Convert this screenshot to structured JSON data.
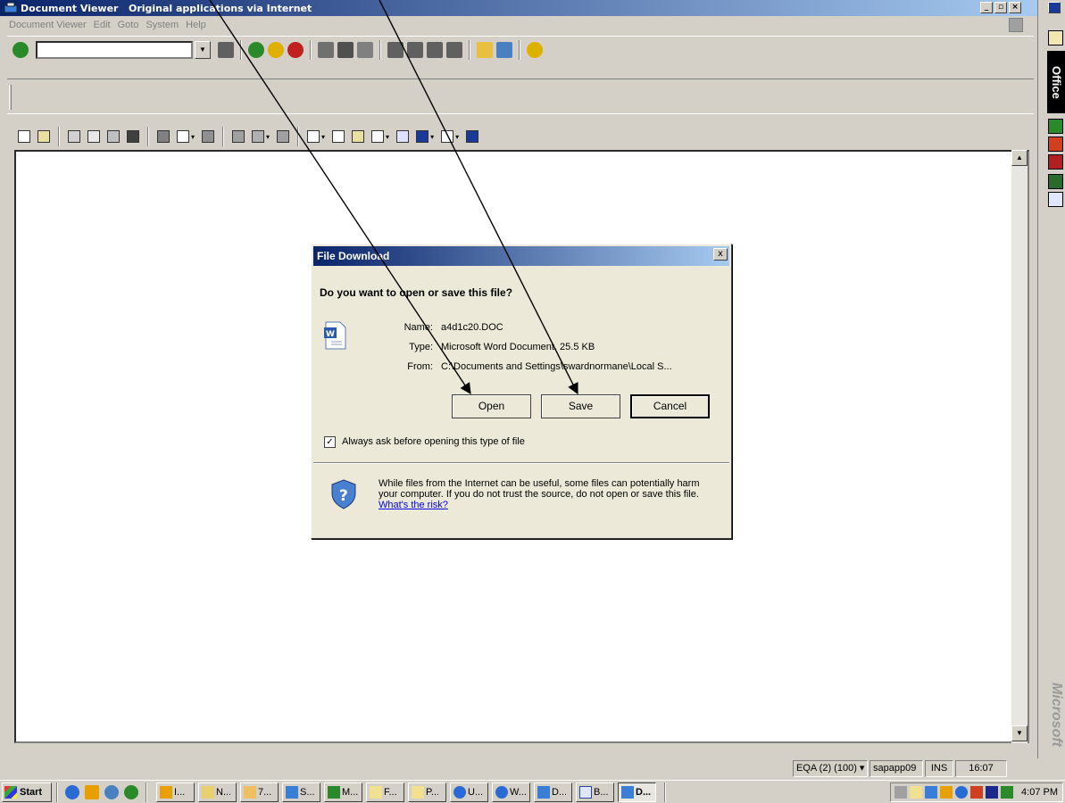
{
  "window": {
    "title": "Document Viewer   Original applications via Internet"
  },
  "menu": [
    "Document Viewer",
    "Edit",
    "Goto",
    "System",
    "Help"
  ],
  "dialog": {
    "title": "File Download",
    "close_label": "x",
    "question": "Do you want to open or save this file?",
    "fields": [
      {
        "label": "Name:",
        "value": "a4d1c20.DOC"
      },
      {
        "label": "Type:",
        "value": "Microsoft Word Document, 25.5 KB"
      },
      {
        "label": "From:",
        "value": "C:\\Documents and Settings\\swardnormane\\Local S..."
      }
    ],
    "buttons": {
      "open": "Open",
      "save": "Save",
      "cancel": "Cancel"
    },
    "checkbox": {
      "checked": true,
      "label": "Always ask before opening this type of file"
    },
    "warning_text": "While files from the Internet can be useful, some files can potentially harm your computer. If you do not trust the source, do not open or save this file.",
    "risk_link": "What's the risk?"
  },
  "statusbar": {
    "system": "EQA (2) (100)",
    "server": "sapapp09",
    "mode": "INS",
    "time": "16:07"
  },
  "taskbar": {
    "start_label": "Start",
    "tasks": [
      "I...",
      "N...",
      "7...",
      "S...",
      "M...",
      "F...",
      "P...",
      "U...",
      "W...",
      "D...",
      "B...",
      "D..."
    ],
    "clock": "4:07 PM"
  },
  "officebar": {
    "label": "Office",
    "brand": "Microsoft"
  },
  "colors": {
    "titlebar_start": "#0a246a",
    "titlebar_end": "#a6caf0",
    "face": "#d4d0c8",
    "dialog_face": "#ece9d8",
    "link": "#0000ee"
  }
}
